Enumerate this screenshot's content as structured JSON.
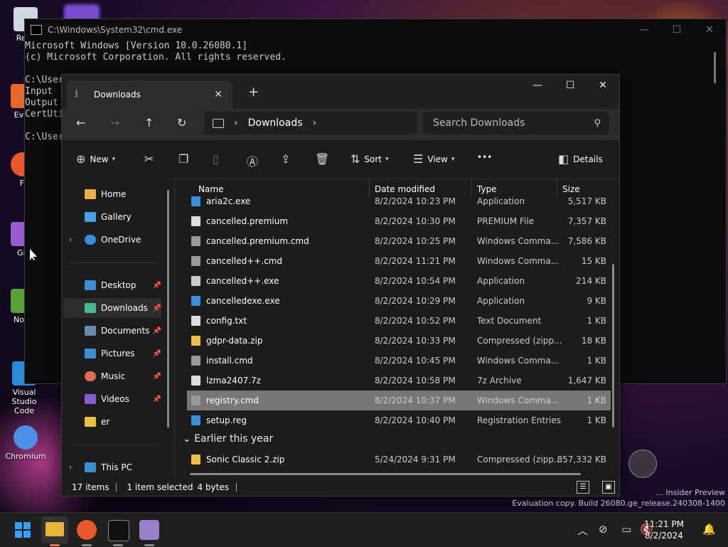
{
  "desktop": {
    "icons": [
      {
        "label": "Recy"
      },
      {
        "label": "Ever"
      },
      {
        "label": "Fi"
      },
      {
        "label": "Git"
      },
      {
        "label": "Note"
      },
      {
        "label": "Visual Studio Code"
      },
      {
        "label": "Chromium"
      }
    ],
    "watermark": {
      "line1": "... Insider Preview",
      "line2": "Evaluation copy. Build 26080.ge_release.240308-1400"
    }
  },
  "cmd": {
    "title": "C:\\Windows\\System32\\cmd.exe",
    "lines": [
      "Microsoft Windows [Version 10.0.26080.1]",
      "(c) Microsoft Corporation. All rights reserved.",
      "",
      "C:\\User",
      "Input",
      "Output",
      "CertUti",
      "",
      "C:\\User"
    ]
  },
  "explorer": {
    "tab_label": "Downloads",
    "new_tab": "+",
    "address": {
      "crumb": "Downloads"
    },
    "search": {
      "placeholder": "Search Downloads"
    },
    "toolbar": {
      "new_label": "New",
      "sort_label": "Sort",
      "view_label": "View",
      "more_label": "•••",
      "details_label": "Details"
    },
    "sidebar": {
      "items": [
        {
          "label": "Home",
          "color": "#e8b04a"
        },
        {
          "label": "Gallery",
          "color": "#4aa0e8"
        },
        {
          "label": "OneDrive",
          "color": "#3a8ee0"
        },
        {
          "label": "Desktop",
          "color": "#3b8fd6"
        },
        {
          "label": "Downloads",
          "color": "#4ab98a"
        },
        {
          "label": "Documents",
          "color": "#6a8ab0"
        },
        {
          "label": "Pictures",
          "color": "#3b8fd6"
        },
        {
          "label": "Music",
          "color": "#e06a5a"
        },
        {
          "label": "Videos",
          "color": "#8a5ad0"
        },
        {
          "label": "er",
          "color": "#e8c04a"
        },
        {
          "label": "This PC",
          "color": "#3b8fd6"
        }
      ]
    },
    "columns": {
      "name": "Name",
      "date": "Date modified",
      "type": "Type",
      "size": "Size"
    },
    "files": [
      {
        "name": "aria2c.exe",
        "date": "8/2/2024 10:23 PM",
        "type": "Application",
        "size": "5,517 KB",
        "color": "#3b8fd6"
      },
      {
        "name": "cancelled.premium",
        "date": "8/2/2024 10:30 PM",
        "type": "PREMIUM File",
        "size": "7,357 KB",
        "color": "#dddddd"
      },
      {
        "name": "cancelled.premium.cmd",
        "date": "8/2/2024 10:25 PM",
        "type": "Windows Comma...",
        "size": "7,586 KB",
        "color": "#999999"
      },
      {
        "name": "cancelled++.cmd",
        "date": "8/2/2024 11:21 PM",
        "type": "Windows Comma...",
        "size": "15 KB",
        "color": "#999999"
      },
      {
        "name": "cancelled++.exe",
        "date": "8/2/2024 10:54 PM",
        "type": "Application",
        "size": "214 KB",
        "color": "#cccccc"
      },
      {
        "name": "cancelledexe.exe",
        "date": "8/2/2024 10:29 PM",
        "type": "Application",
        "size": "9 KB",
        "color": "#3b8fd6"
      },
      {
        "name": "config.txt",
        "date": "8/2/2024 10:52 PM",
        "type": "Text Document",
        "size": "1 KB",
        "color": "#dddddd"
      },
      {
        "name": "gdpr-data.zip",
        "date": "8/2/2024 10:33 PM",
        "type": "Compressed (zipp...",
        "size": "18 KB",
        "color": "#e8c04a"
      },
      {
        "name": "install.cmd",
        "date": "8/2/2024 10:45 PM",
        "type": "Windows Comma...",
        "size": "1 KB",
        "color": "#999999"
      },
      {
        "name": "lzma2407.7z",
        "date": "8/2/2024 10:58 PM",
        "type": "7z Archive",
        "size": "1,647 KB",
        "color": "#dddddd"
      },
      {
        "name": "registry.cmd",
        "date": "8/2/2024 10:37 PM",
        "type": "Windows Comma...",
        "size": "1 KB",
        "color": "#999999"
      },
      {
        "name": "setup.reg",
        "date": "8/2/2024 10:40 PM",
        "type": "Registration Entries",
        "size": "1 KB",
        "color": "#3b8fd6"
      }
    ],
    "group_label": "Earlier this year",
    "earlier_files": [
      {
        "name": "Sonic Classic 2.zip",
        "date": "5/24/2024 9:31 PM",
        "type": "Compressed (zipp...",
        "size": "857,332 KB",
        "color": "#e8c04a"
      }
    ],
    "status": {
      "count": "17 items",
      "selected": "1 item selected",
      "size": "4 bytes"
    }
  },
  "taskbar": {
    "time": "11:21 PM",
    "date": "8/2/2024"
  }
}
